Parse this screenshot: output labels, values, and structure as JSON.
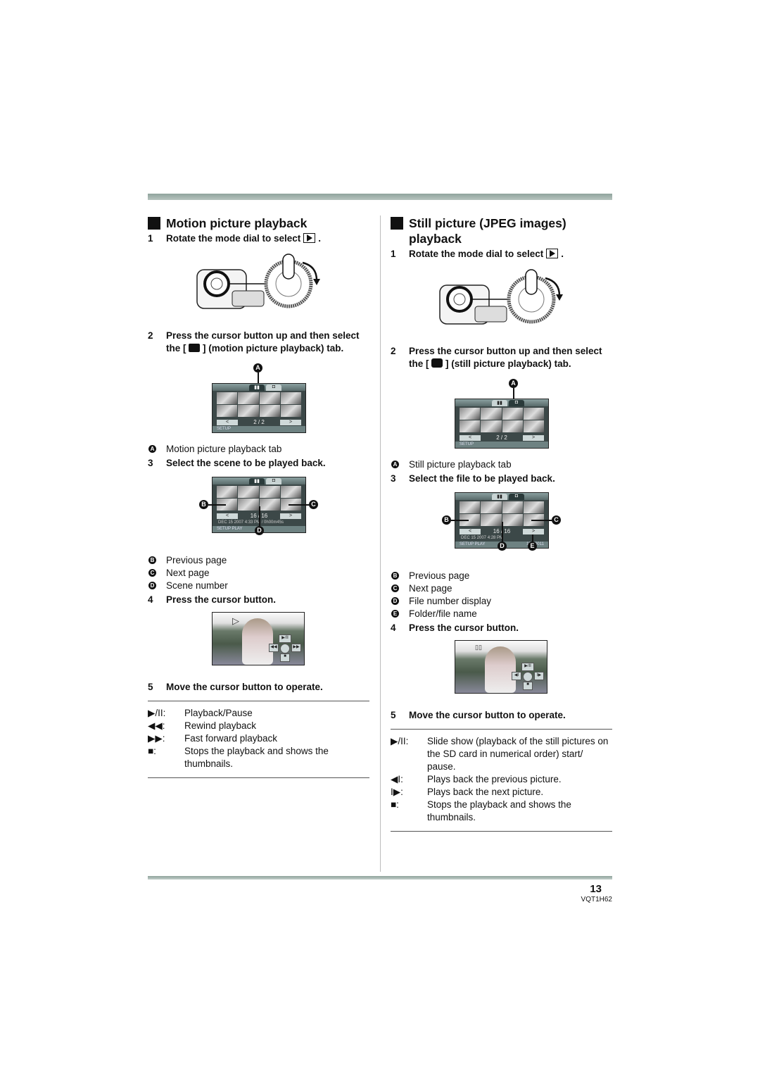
{
  "left": {
    "heading": "Motion picture playback",
    "step1": {
      "num": "1",
      "text": "Rotate the mode dial to select",
      "tail": "."
    },
    "step2": {
      "num": "2",
      "text_a": "Press the cursor button up and then select the [",
      "text_b": "] (motion picture playback) tab.",
      "icon": "movie-camera-icon"
    },
    "screen1": {
      "callout": "A",
      "page": "2 / 2",
      "prev": "<",
      "next": ">",
      "status": "SETUP"
    },
    "legendA": {
      "badge": "A",
      "text": "Motion picture playback tab"
    },
    "step3": {
      "num": "3",
      "text": "Select the scene to be played back."
    },
    "screen2": {
      "page": "16 / 16",
      "info": "DEC 15 2007  4:33 PM / 0h00m45s",
      "status": "SETUP  PLAY",
      "callouts": [
        "B",
        "C",
        "D"
      ]
    },
    "legend": [
      {
        "badge": "B",
        "text": "Previous page"
      },
      {
        "badge": "C",
        "text": "Next page"
      },
      {
        "badge": "D",
        "text": "Scene number"
      }
    ],
    "step4": {
      "num": "4",
      "text": "Press the cursor button."
    },
    "playscreen": {
      "indicator": "▷",
      "controls": {
        "up": "▶/II",
        "left": "◀◀",
        "right": "▶▶",
        "down": "■"
      }
    },
    "step5": {
      "num": "5",
      "text": "Move the cursor button to operate."
    },
    "ops": [
      {
        "key": "▶/II:",
        "desc": "Playback/Pause"
      },
      {
        "key": "◀◀:",
        "desc": "Rewind playback"
      },
      {
        "key": "▶▶:",
        "desc": "Fast forward playback"
      },
      {
        "key": "■:",
        "desc": "Stops the playback and shows the thumbnails."
      }
    ]
  },
  "right": {
    "heading": "Still picture (JPEG images) playback",
    "step1": {
      "num": "1",
      "text": "Rotate the mode dial to select",
      "tail": "."
    },
    "step2": {
      "num": "2",
      "text_a": "Press the cursor button up and then select the [",
      "text_b": "] (still picture playback) tab.",
      "icon": "still-camera-icon"
    },
    "screen1": {
      "callout": "A",
      "page": "2 / 2",
      "prev": "<",
      "next": ">",
      "status": "SETUP"
    },
    "legendA": {
      "badge": "A",
      "text": "Still picture playback tab"
    },
    "step3": {
      "num": "3",
      "text": "Select the file to be played back."
    },
    "screen2": {
      "page": "16 / 16",
      "info": "DEC 15 2007  4:28 PM",
      "status": "SETUP  PLAY",
      "folder": "100-0011",
      "callouts": [
        "B",
        "C",
        "D",
        "E"
      ]
    },
    "legend": [
      {
        "badge": "B",
        "text": "Previous page"
      },
      {
        "badge": "C",
        "text": "Next page"
      },
      {
        "badge": "D",
        "text": "File number display"
      },
      {
        "badge": "E",
        "text": "Folder/file name"
      }
    ],
    "step4": {
      "num": "4",
      "text": "Press the cursor button."
    },
    "playscreen": {
      "indicator": "▯▯",
      "controls": {
        "up": "▶/II",
        "left": "◀I",
        "right": "I▶",
        "down": "■"
      }
    },
    "step5": {
      "num": "5",
      "text": "Move the cursor button to operate."
    },
    "ops": [
      {
        "key": "▶/II:",
        "desc": "Slide show (playback of the still pictures on the SD card in numerical order) start/ pause."
      },
      {
        "key": "◀I:",
        "desc": "Plays back the previous picture."
      },
      {
        "key": "I▶:",
        "desc": "Plays back the next picture."
      },
      {
        "key": "■:",
        "desc": "Stops the playback and shows the thumbnails."
      }
    ]
  },
  "footer": {
    "page_number": "13",
    "model_code": "VQT1H62"
  }
}
